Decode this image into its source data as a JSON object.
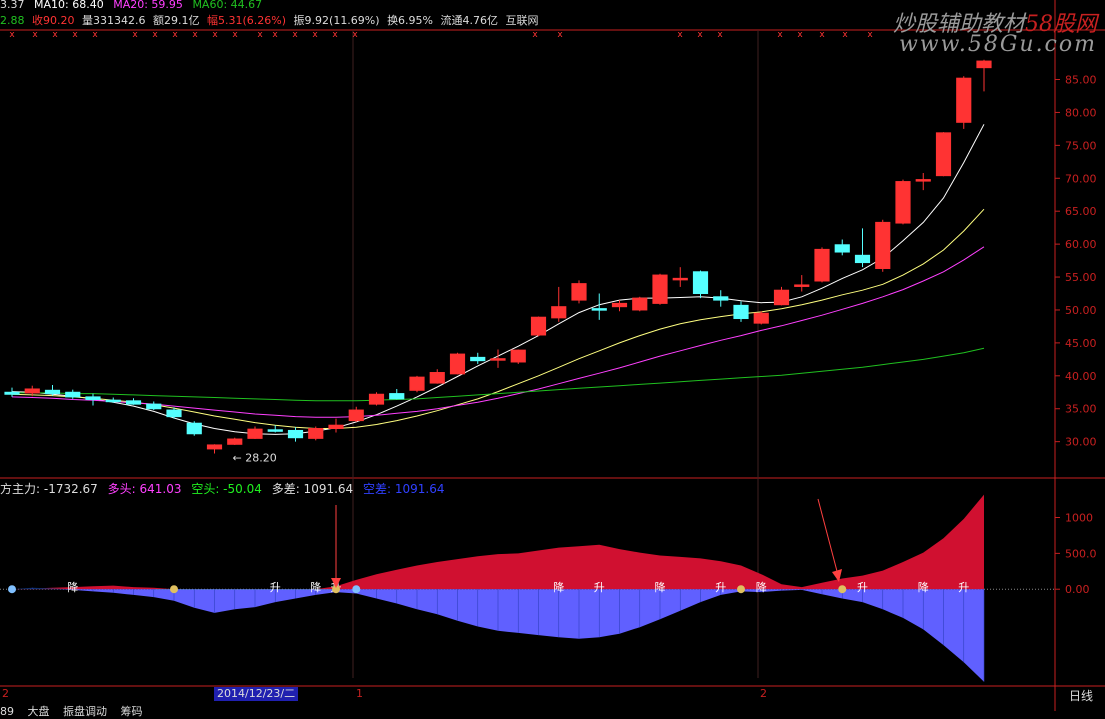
{
  "header_top": {
    "close": "3.37",
    "ma10": "MA10: 68.40",
    "ma20": "MA20: 59.95",
    "ma60": "MA60: 44.67"
  },
  "header_info": {
    "a": "2.88",
    "close": "收90.20",
    "volume": "量331342.6",
    "amount": "额29.1亿",
    "change": "幅5.31(6.26%)",
    "amplitude": "振9.92(11.69%)",
    "turnover": "换6.95%",
    "float": "流通4.76亿",
    "source": "互联网"
  },
  "watermark": {
    "line1_prefix": "炒股辅助教材",
    "line1_brand": "58股网",
    "line2": "www.58Gu.com"
  },
  "indicator_header": {
    "title": "方主力: -1732.67",
    "long": "多头: 641.03",
    "short": "空头: -50.04",
    "diff": "多差: 1091.64",
    "empty": "空差: 1091.64"
  },
  "bottom": {
    "left_mark": "2",
    "date": "2014/12/23/二",
    "mid_mark": "1",
    "mid_mark2": "2",
    "period": "日线"
  },
  "tabs": [
    "89",
    "大盘",
    "振盘调动",
    "筹码"
  ],
  "colors": {
    "up": "#ff3333",
    "down": "#55ffff",
    "ma10": "#ffffff",
    "ma20": "#ffff80",
    "ma60": "#ff40ff",
    "ma120": "#20c020",
    "long_fill": "#d01030",
    "short_fill": "#6060ff",
    "green_fill": "#20f020",
    "navy_fill": "#103070",
    "axis": "#c82020"
  },
  "chart_data": [
    {
      "type": "candlestick",
      "y_axis_ticks": [
        "85.00",
        "80.00",
        "75.00",
        "70.00",
        "65.00",
        "60.00",
        "55.00",
        "50.00",
        "45.00",
        "40.00",
        "35.00",
        "30.00"
      ],
      "ylim": [
        26,
        91
      ],
      "low_annotation": "28.20",
      "candles": [
        [
          37.5,
          38.2,
          36.8,
          37.2
        ],
        [
          37.4,
          38.5,
          36.9,
          38.0
        ],
        [
          37.8,
          38.6,
          37.0,
          37.3
        ],
        [
          37.5,
          37.9,
          36.5,
          36.8
        ],
        [
          36.8,
          37.3,
          35.5,
          36.4
        ],
        [
          36.3,
          36.7,
          35.9,
          36.1
        ],
        [
          36.2,
          36.6,
          35.6,
          35.7
        ],
        [
          35.7,
          36.1,
          34.8,
          35.0
        ],
        [
          34.8,
          35.2,
          33.5,
          33.8
        ],
        [
          32.8,
          33.1,
          30.9,
          31.2
        ],
        [
          28.9,
          29.6,
          28.2,
          29.5
        ],
        [
          29.6,
          30.6,
          29.5,
          30.4
        ],
        [
          30.5,
          32.3,
          30.4,
          31.9
        ],
        [
          31.8,
          32.5,
          31.4,
          31.7
        ],
        [
          31.7,
          32.2,
          30.0,
          30.6
        ],
        [
          30.5,
          32.3,
          30.2,
          32.0
        ],
        [
          32.0,
          33.5,
          31.4,
          32.5
        ],
        [
          33.2,
          35.3,
          33.0,
          34.8
        ],
        [
          35.7,
          37.5,
          35.5,
          37.2
        ],
        [
          37.3,
          38.0,
          36.4,
          36.5
        ],
        [
          37.8,
          40.0,
          37.5,
          39.8
        ],
        [
          38.9,
          41.0,
          38.8,
          40.5
        ],
        [
          40.3,
          43.5,
          40.2,
          43.3
        ],
        [
          42.8,
          43.5,
          41.8,
          42.3
        ],
        [
          42.6,
          44.0,
          41.2,
          42.6
        ],
        [
          42.1,
          44.0,
          41.8,
          43.9
        ],
        [
          46.2,
          49.0,
          46.0,
          48.9
        ],
        [
          48.8,
          53.5,
          48.2,
          50.5
        ],
        [
          51.5,
          54.5,
          51.0,
          54.0
        ],
        [
          50.2,
          52.5,
          48.5,
          50.0
        ],
        [
          50.5,
          51.5,
          49.8,
          51.0
        ],
        [
          50.0,
          52.0,
          49.8,
          51.8
        ],
        [
          51.0,
          55.5,
          50.8,
          55.3
        ],
        [
          54.8,
          56.5,
          53.5,
          54.8
        ],
        [
          55.8,
          56.0,
          51.8,
          52.5
        ],
        [
          52.0,
          53.0,
          50.5,
          51.5
        ],
        [
          50.7,
          51.3,
          48.2,
          48.7
        ],
        [
          48.0,
          49.8,
          47.8,
          49.5
        ],
        [
          50.8,
          53.5,
          50.7,
          53.0
        ],
        [
          53.6,
          55.3,
          52.8,
          53.8
        ],
        [
          54.4,
          59.5,
          54.2,
          59.2
        ],
        [
          59.9,
          60.7,
          58.3,
          58.8
        ],
        [
          58.3,
          62.4,
          56.5,
          57.2
        ],
        [
          56.3,
          63.7,
          55.8,
          63.3
        ],
        [
          63.2,
          69.8,
          63.0,
          69.5
        ],
        [
          69.6,
          70.8,
          68.2,
          69.8
        ],
        [
          70.4,
          77.0,
          70.3,
          76.9
        ],
        [
          78.5,
          85.5,
          77.5,
          85.2
        ],
        [
          86.8,
          88.0,
          83.2,
          87.8
        ]
      ],
      "ma_series": [
        {
          "name": "MA10",
          "values": [
            37.6,
            37.5,
            37.2,
            36.9,
            36.5,
            36.0,
            35.4,
            34.6,
            33.6,
            32.7,
            32.0,
            31.5,
            31.2,
            31.1,
            31.2,
            31.6,
            32.1,
            33.0,
            34.1,
            35.4,
            36.8,
            38.3,
            39.9,
            41.5,
            43.0,
            44.5,
            46.1,
            47.9,
            49.6,
            50.8,
            51.5,
            51.8,
            51.8,
            51.9,
            52.0,
            51.8,
            51.4,
            51.1,
            51.2,
            52.0,
            53.3,
            54.8,
            56.1,
            57.9,
            60.5,
            63.3,
            67.0,
            72.4,
            78.2
          ]
        },
        {
          "name": "MA20",
          "values": [
            37.2,
            37.1,
            37.0,
            36.8,
            36.6,
            36.3,
            36.0,
            35.6,
            35.1,
            34.5,
            33.9,
            33.4,
            32.9,
            32.5,
            32.2,
            32.0,
            32.0,
            32.2,
            32.6,
            33.2,
            33.9,
            34.7,
            35.6,
            36.5,
            37.6,
            38.8,
            40.0,
            41.3,
            42.6,
            43.8,
            45.0,
            46.1,
            47.1,
            47.9,
            48.5,
            49.0,
            49.4,
            49.7,
            50.2,
            50.8,
            51.5,
            52.3,
            53.0,
            53.9,
            55.3,
            57.0,
            59.1,
            62.0,
            65.3
          ]
        },
        {
          "name": "MA60",
          "values": [
            36.8,
            36.7,
            36.6,
            36.4,
            36.3,
            36.1,
            35.9,
            35.7,
            35.4,
            35.1,
            34.8,
            34.5,
            34.2,
            34.0,
            33.8,
            33.7,
            33.7,
            33.8,
            34.0,
            34.3,
            34.6,
            35.0,
            35.5,
            36.0,
            36.6,
            37.3,
            38.0,
            38.8,
            39.6,
            40.4,
            41.2,
            42.1,
            43.0,
            43.8,
            44.6,
            45.4,
            46.1,
            46.9,
            47.6,
            48.4,
            49.2,
            50.1,
            51.0,
            52.0,
            53.1,
            54.4,
            55.8,
            57.6,
            59.6
          ]
        },
        {
          "name": "MA120",
          "values": [
            37.4,
            37.4,
            37.4,
            37.3,
            37.3,
            37.2,
            37.1,
            37.0,
            36.9,
            36.8,
            36.7,
            36.6,
            36.5,
            36.4,
            36.3,
            36.2,
            36.2,
            36.2,
            36.3,
            36.4,
            36.5,
            36.7,
            36.9,
            37.1,
            37.3,
            37.5,
            37.7,
            37.9,
            38.1,
            38.3,
            38.5,
            38.7,
            38.9,
            39.1,
            39.3,
            39.5,
            39.7,
            39.9,
            40.1,
            40.4,
            40.7,
            41.0,
            41.3,
            41.7,
            42.1,
            42.5,
            43.0,
            43.5,
            44.2
          ]
        }
      ]
    },
    {
      "type": "area",
      "y_axis_ticks": [
        "1000",
        "500.0",
        "0.00"
      ],
      "ylim": [
        -1350,
        1300
      ],
      "series": [
        {
          "name": "多头",
          "values": [
            0,
            10,
            20,
            30,
            40,
            50,
            30,
            20,
            -30,
            -60,
            -110,
            -130,
            -120,
            -90,
            -60,
            -20,
            40,
            130,
            210,
            270,
            330,
            380,
            420,
            460,
            490,
            500,
            540,
            580,
            600,
            620,
            560,
            510,
            470,
            450,
            430,
            390,
            330,
            210,
            70,
            30,
            90,
            150,
            190,
            260,
            380,
            510,
            710,
            980,
            1320
          ]
        },
        {
          "name": "空头",
          "values": [
            0,
            20,
            10,
            -10,
            -30,
            -50,
            -80,
            -110,
            -160,
            -260,
            -330,
            -280,
            -250,
            -180,
            -130,
            -80,
            -40,
            -60,
            -130,
            -200,
            -280,
            -350,
            -440,
            -520,
            -580,
            -610,
            -640,
            -670,
            -690,
            -670,
            -620,
            -530,
            -420,
            -300,
            -180,
            -80,
            -30,
            -40,
            -20,
            -10,
            -70,
            -130,
            -180,
            -280,
            -400,
            -560,
            -780,
            -1020,
            -1290
          ]
        }
      ],
      "markers": [
        "降",
        "升",
        "降",
        "升",
        "降",
        "升",
        "降",
        "升",
        "降",
        "升",
        "降",
        "升"
      ]
    }
  ]
}
